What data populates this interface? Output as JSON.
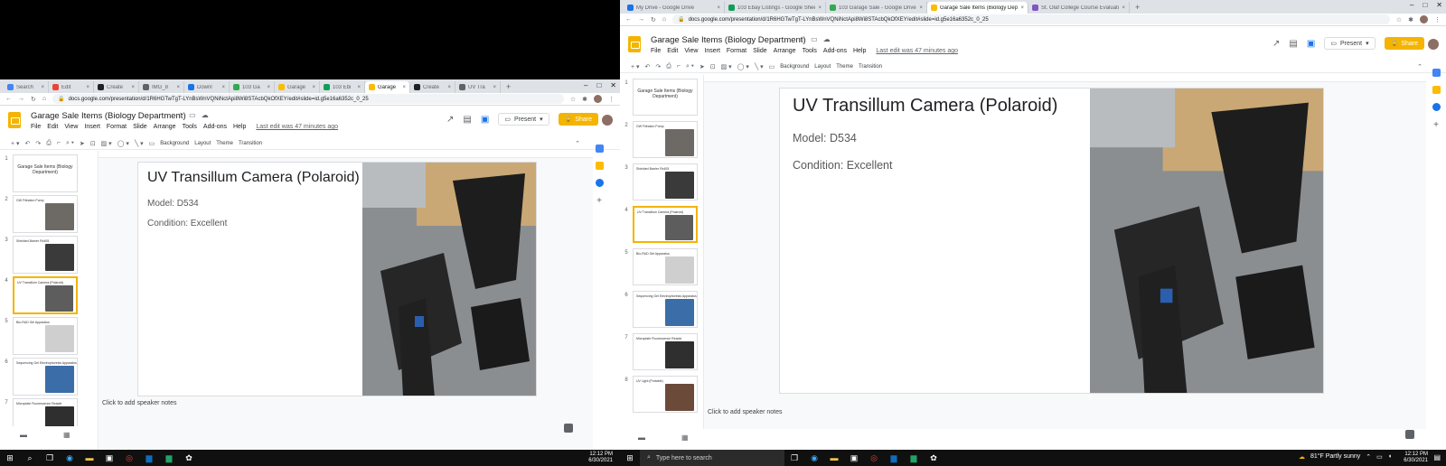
{
  "left_window": {
    "tabs": [
      {
        "label": "Search",
        "color": "#4285f4"
      },
      {
        "label": "Edit",
        "color": "#ea4335"
      },
      {
        "label": "Create",
        "color": "#202124"
      },
      {
        "label": "IMG_8",
        "color": "#5f6368"
      },
      {
        "label": "Downl",
        "color": "#1a73e8"
      },
      {
        "label": "103 Ga",
        "color": "#34a853"
      },
      {
        "label": "Garage",
        "color": "#fbbc04"
      },
      {
        "label": "103 Ebi",
        "color": "#0f9d58"
      },
      {
        "label": "Garage",
        "color": "#fbbc04",
        "active": true
      },
      {
        "label": "Create",
        "color": "#202124"
      },
      {
        "label": "UV Tra",
        "color": "#5f6368"
      }
    ],
    "url": "docs.google.com/presentation/d/1R6HGTwTgT-LYnBsWnVQNiNctApi8Wi8STAcbQkOfXEY/edit#slide=id.g5e16a6352c_0_25",
    "doc_title": "Garage Sale Items (Biology Department)",
    "last_edit": "Last edit was 47 minutes ago",
    "notes_placeholder": "Click to add speaker notes",
    "taskbar_time": "12:12 PM",
    "taskbar_date": "6/30/2021"
  },
  "right_window": {
    "tabs": [
      {
        "label": "My Drive - Google Drive",
        "color": "#1a73e8"
      },
      {
        "label": "103 Ebay Listings - Google Sheets",
        "color": "#0f9d58"
      },
      {
        "label": "103 Garage Sale - Google Drive",
        "color": "#34a853"
      },
      {
        "label": "Garage Sale Items (Biology Depa...",
        "color": "#fbbc04",
        "active": true
      },
      {
        "label": "St. Olaf College Course Evaluati...",
        "color": "#7e57c2"
      }
    ],
    "url": "docs.google.com/presentation/d/1R6HGTwTgT-LYnBsWnVQNiNctApi8Wi8STAcbQkOfXEY/edit#slide=id.g5e16a6352c_0_25",
    "doc_title": "Garage Sale Items (Biology Department)",
    "last_edit": "Last edit was 47 minutes ago",
    "notes_placeholder": "Click to add speaker notes",
    "search_placeholder": "Type here to search",
    "weather": "81°F  Partly sunny",
    "taskbar_time": "12:12 PM",
    "taskbar_date": "6/30/2021"
  },
  "menu": [
    "File",
    "Edit",
    "View",
    "Insert",
    "Format",
    "Slide",
    "Arrange",
    "Tools",
    "Add-ons",
    "Help"
  ],
  "toolbar": {
    "background": "Background",
    "layout": "Layout",
    "theme": "Theme",
    "transition": "Transition"
  },
  "buttons": {
    "present": "Present",
    "share": "Share"
  },
  "slide": {
    "title": "UV Transillum Camera (Polaroid)",
    "model": "Model: D534",
    "condition": "Condition: Excellent"
  },
  "thumbnails": [
    {
      "num": "1",
      "title": "Garage Sale Items (Biology Department)"
    },
    {
      "num": "2",
      "title": "GW Filtration Pump"
    },
    {
      "num": "3",
      "title": "Shielded Barrier Rx405"
    },
    {
      "num": "4",
      "title": "UV Transillum Camera (Polaroid)"
    },
    {
      "num": "5",
      "title": "Bio-RAD Gel Apparatus"
    },
    {
      "num": "6",
      "title": "Sequencing Gel Electrophoresis Apparatus"
    },
    {
      "num": "7",
      "title": "Microplate Fluorescence Reader"
    },
    {
      "num": "8",
      "title": "UV Light (Portable)"
    }
  ],
  "selected_slide": 4
}
